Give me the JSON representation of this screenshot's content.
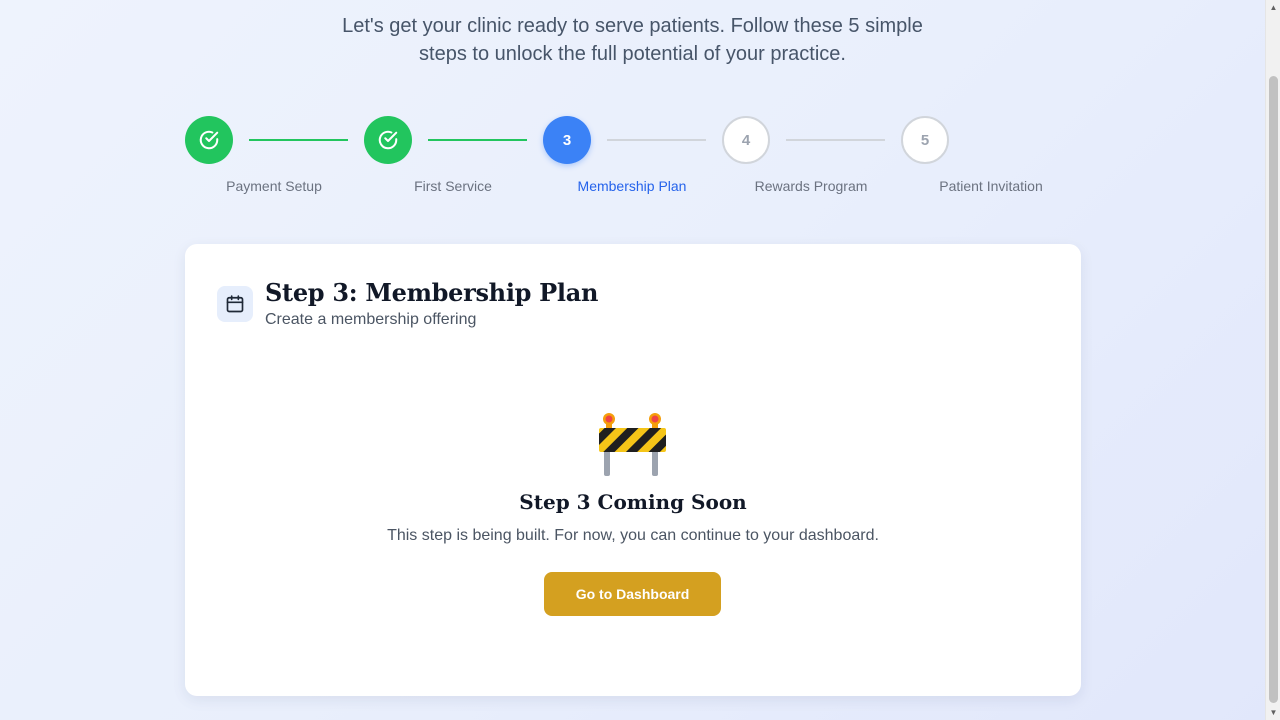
{
  "intro": {
    "line1": "Let's get your clinic ready to serve patients. Follow these 5 simple",
    "line2": "steps to unlock the full potential of your practice."
  },
  "stepper": {
    "steps": [
      {
        "number": "1",
        "label": "Payment Setup",
        "status": "completed",
        "icon": "check-circle-icon"
      },
      {
        "number": "2",
        "label": "First Service",
        "status": "completed",
        "icon": "check-circle-icon"
      },
      {
        "number": "3",
        "label": "Membership Plan",
        "status": "current"
      },
      {
        "number": "4",
        "label": "Rewards Program",
        "status": "pending"
      },
      {
        "number": "5",
        "label": "Patient Invitation",
        "status": "pending"
      }
    ]
  },
  "card": {
    "icon": "calendar-icon",
    "title": "Step 3: Membership Plan",
    "subtitle": "Create a membership offering",
    "placeholder": {
      "icon": "construction-barrier-icon",
      "title": "Step 3 Coming Soon",
      "text": "This step is being built. For now, you can continue to your dashboard.",
      "button_label": "Go to Dashboard"
    }
  },
  "colors": {
    "completed": "#22c55e",
    "current": "#3b82f6",
    "current_label": "#2563eb",
    "pending_border": "#d1d5db",
    "button": "#d4a020"
  }
}
